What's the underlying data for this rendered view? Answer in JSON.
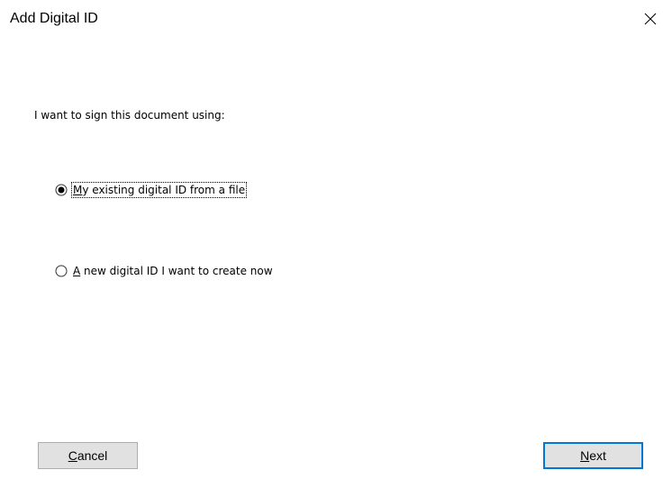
{
  "window": {
    "title": "Add Digital ID"
  },
  "prompt": "I want to sign this document using:",
  "options": [
    {
      "first_letter": "M",
      "rest": "y existing digital ID from a file",
      "selected": true
    },
    {
      "first_letter": "A",
      "rest": " new digital ID I want to create now",
      "selected": false
    }
  ],
  "buttons": {
    "cancel": {
      "first_letter": "C",
      "rest": "ancel"
    },
    "next": {
      "first_letter": "N",
      "rest": "ext"
    }
  },
  "colors": {
    "accent": "#0078d7",
    "button_face": "#e1e1e1",
    "button_border": "#adadad"
  },
  "icons": {
    "close": "close-icon",
    "radio_selected": "radio-selected-icon",
    "radio_unselected": "radio-unselected-icon"
  }
}
